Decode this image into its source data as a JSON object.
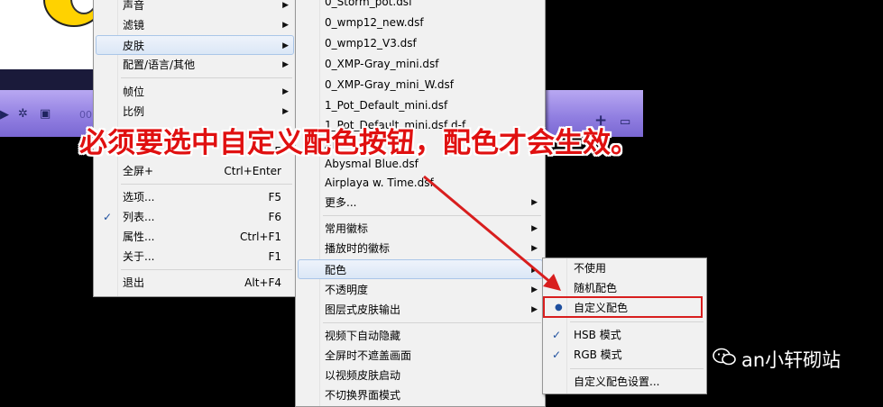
{
  "annotation": "必须要选中自定义配色按钮，配色才会生效。",
  "watermark": "an小轩砌站",
  "player": {
    "time_partial": "00",
    "icons": [
      "play-icon",
      "gear-icon",
      "screen-icon",
      "plus-icon",
      "list-icon"
    ]
  },
  "menu1": {
    "items": [
      {
        "label": "声音",
        "submenu": true
      },
      {
        "label": "滤镜",
        "submenu": true
      },
      {
        "label": "皮肤",
        "submenu": true,
        "highlight": true
      },
      {
        "label": "配置/语言/其他",
        "submenu": true
      },
      {
        "label": "帧位",
        "submenu": true
      },
      {
        "label": "比例",
        "submenu": true
      },
      {
        "label": "",
        "shortcut": "E"
      },
      {
        "label": "全屏+",
        "shortcut": "Ctrl+Enter"
      },
      {
        "label": "选项...",
        "shortcut": "F5"
      },
      {
        "label": "列表...",
        "shortcut": "F6",
        "checked": true
      },
      {
        "label": "属性...",
        "shortcut": "Ctrl+F1"
      },
      {
        "label": "关于...",
        "shortcut": "F1"
      },
      {
        "label": "退出",
        "shortcut": "Alt+F4"
      }
    ]
  },
  "menu2": {
    "items": [
      {
        "label": "0_Storm_pot.dsf"
      },
      {
        "label": "0_wmp12_new.dsf"
      },
      {
        "label": "0_wmp12_V3.dsf"
      },
      {
        "label": "0_XMP-Gray_mini.dsf"
      },
      {
        "label": "0_XMP-Gray_mini_W.dsf"
      },
      {
        "label": "1_Pot_Default_mini.dsf"
      },
      {
        "label": "1_Pot_Default_mini.dsf d-f"
      },
      {
        "label": "Ab"
      },
      {
        "label": "Abysmal Blue.dsf"
      },
      {
        "label": "Airplaya w. Time.dsf"
      },
      {
        "label": "更多...",
        "submenu": true
      },
      {
        "label": "常用徽标",
        "submenu": true
      },
      {
        "label": "播放时的徽标",
        "submenu": true
      },
      {
        "label": "配色",
        "submenu": true,
        "highlight": true
      },
      {
        "label": "不透明度",
        "submenu": true
      },
      {
        "label": "图层式皮肤输出",
        "submenu": true
      },
      {
        "label": "视频下自动隐藏"
      },
      {
        "label": "全屏时不遮盖画面"
      },
      {
        "label": "以视频皮肤启动"
      },
      {
        "label": "不切换界面模式"
      }
    ]
  },
  "menu3": {
    "items": [
      {
        "label": "不使用"
      },
      {
        "label": "随机配色"
      },
      {
        "label": "自定义配色",
        "selected": true
      },
      {
        "label": "HSB 模式",
        "checked": true
      },
      {
        "label": "RGB 模式",
        "checked": true
      },
      {
        "label": "自定义配色设置..."
      }
    ]
  },
  "colors": {
    "annotation": "#e01010",
    "highlight_box": "#d81e1e",
    "arrow": "#d81e1e"
  }
}
